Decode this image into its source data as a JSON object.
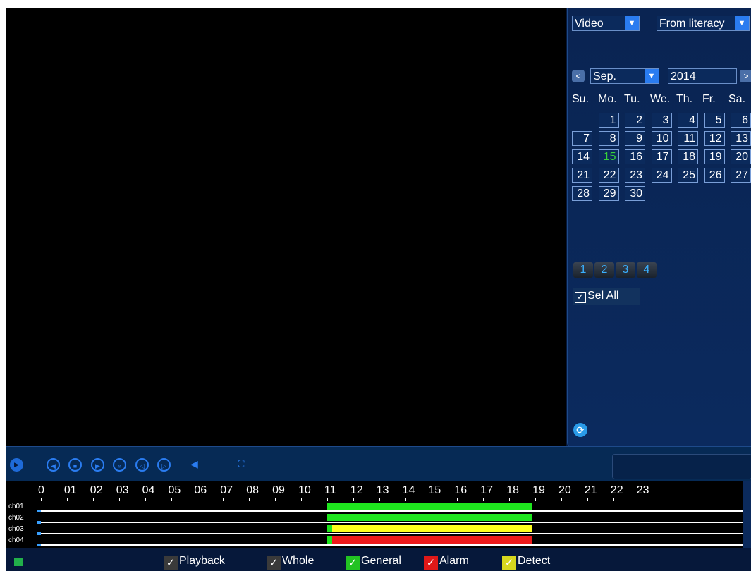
{
  "sidebar": {
    "type_select": "Video",
    "source_select": "From literacy",
    "prev_month_label": "<",
    "next_month_label": ">",
    "month_select": "Sep.",
    "year_input": "2014",
    "weekdays": [
      "Su.",
      "Mo.",
      "Tu.",
      "We.",
      "Th.",
      "Fr.",
      "Sa."
    ],
    "selected_day": "15",
    "days": [
      [
        "",
        "1",
        "2",
        "3",
        "4",
        "5",
        "6"
      ],
      [
        "7",
        "8",
        "9",
        "10",
        "11",
        "12",
        "13"
      ],
      [
        "14",
        "15",
        "16",
        "17",
        "18",
        "19",
        "20"
      ],
      [
        "21",
        "22",
        "23",
        "24",
        "25",
        "26",
        "27"
      ],
      [
        "28",
        "29",
        "30",
        "",
        "",
        "",
        ""
      ]
    ],
    "channel_tabs": [
      "1",
      "2",
      "3",
      "4"
    ],
    "sel_all_label": "Sel All"
  },
  "controls": {
    "icons": [
      "play-icon",
      "reverse-play-icon",
      "stop-icon",
      "slow-play-icon",
      "fast-forward-icon",
      "previous-frame-icon",
      "next-frame-icon",
      "volume-icon",
      "fullscreen-icon"
    ]
  },
  "timeline": {
    "hours": [
      "0",
      "01",
      "02",
      "03",
      "04",
      "05",
      "06",
      "07",
      "08",
      "09",
      "10",
      "11",
      "12",
      "13",
      "14",
      "15",
      "16",
      "17",
      "18",
      "19",
      "20",
      "21",
      "22",
      "23"
    ],
    "channels": [
      "ch01",
      "ch02",
      "ch03",
      "ch04"
    ],
    "records": [
      {
        "channel": "ch01",
        "type": "General",
        "start": 11.0,
        "end": 18.9
      },
      {
        "channel": "ch02",
        "type": "General",
        "start": 11.0,
        "end": 18.9
      },
      {
        "channel": "ch03",
        "type": "General",
        "start": 11.0,
        "end": 11.2
      },
      {
        "channel": "ch03",
        "type": "Detect",
        "start": 11.2,
        "end": 18.9
      },
      {
        "channel": "ch04",
        "type": "General",
        "start": 11.0,
        "end": 11.2
      },
      {
        "channel": "ch04",
        "type": "Alarm",
        "start": 11.2,
        "end": 18.9
      }
    ]
  },
  "legend": [
    {
      "label": "Playback",
      "color": "#3a3a3a"
    },
    {
      "label": "Whole",
      "color": "#3a3a3a"
    },
    {
      "label": "General",
      "color": "#22c322"
    },
    {
      "label": "Alarm",
      "color": "#e01818"
    },
    {
      "label": "Detect",
      "color": "#d8d81e"
    }
  ],
  "colors": {
    "accent": "#2a7cf0",
    "general": "#1ee61e",
    "alarm": "#ee1a1a",
    "detect": "#ffff1e",
    "today": "#36d13a"
  }
}
